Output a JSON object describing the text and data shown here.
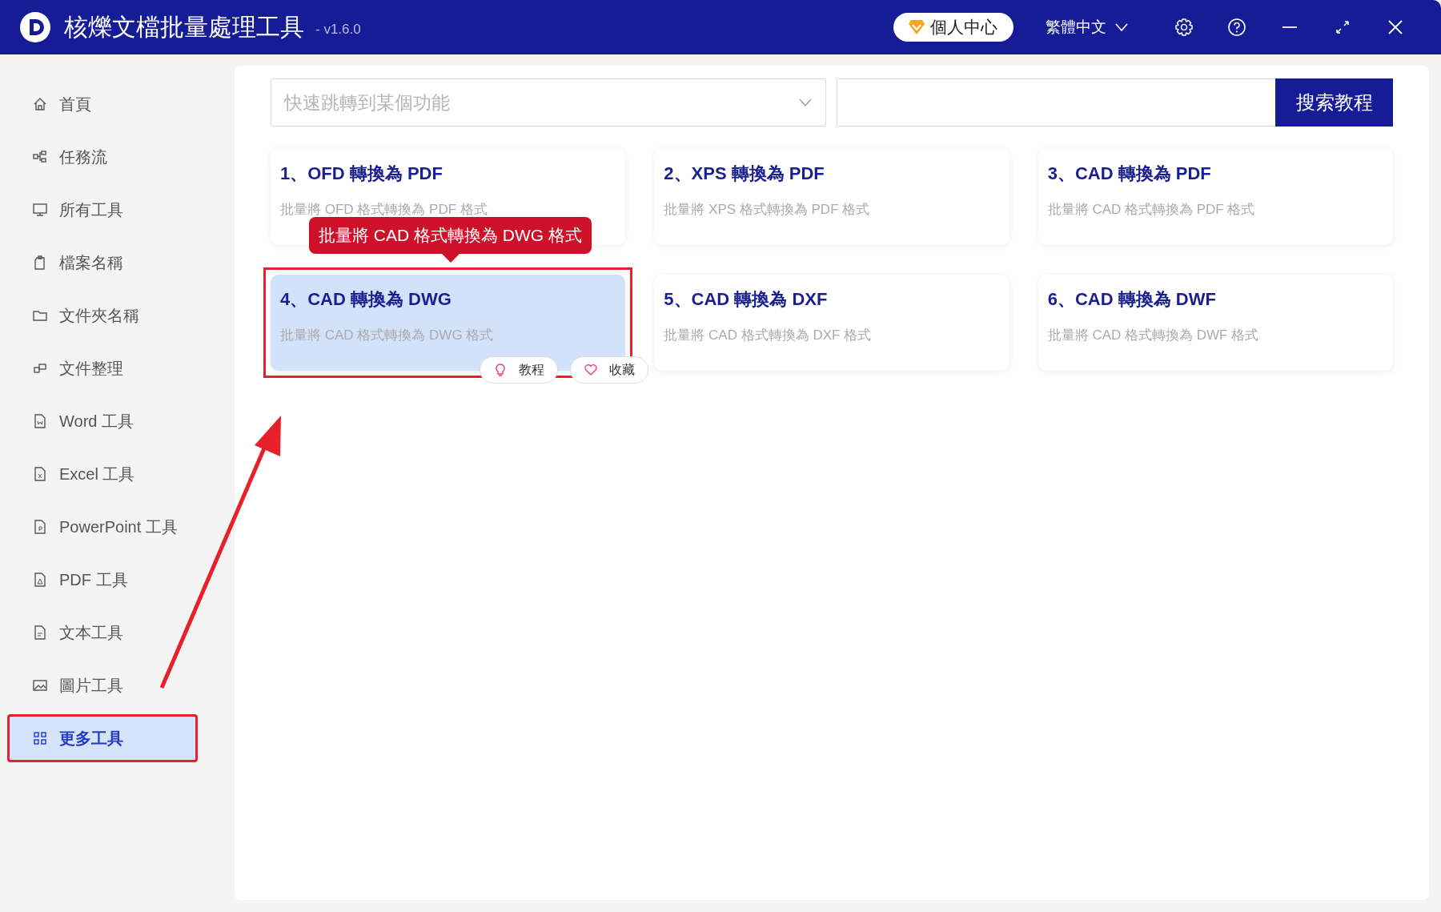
{
  "window": {
    "title": "核爍文檔批量處理工具",
    "version": "- v1.6.0"
  },
  "header": {
    "account_button": "個人中心",
    "language": "繁體中文"
  },
  "sidebar": {
    "items": [
      {
        "label": "首頁",
        "selected": false,
        "highlighted": false
      },
      {
        "label": "任務流",
        "selected": false,
        "highlighted": false
      },
      {
        "label": "所有工具",
        "selected": false,
        "highlighted": false
      },
      {
        "label": "檔案名稱",
        "selected": false,
        "highlighted": false
      },
      {
        "label": "文件夾名稱",
        "selected": false,
        "highlighted": false
      },
      {
        "label": "文件整理",
        "selected": false,
        "highlighted": false
      },
      {
        "label": "Word 工具",
        "selected": false,
        "highlighted": false
      },
      {
        "label": "Excel 工具",
        "selected": false,
        "highlighted": false
      },
      {
        "label": "PowerPoint 工具",
        "selected": false,
        "highlighted": false
      },
      {
        "label": "PDF 工具",
        "selected": false,
        "highlighted": false
      },
      {
        "label": "文本工具",
        "selected": false,
        "highlighted": false
      },
      {
        "label": "圖片工具",
        "selected": false,
        "highlighted": false
      },
      {
        "label": "更多工具",
        "selected": true,
        "highlighted": true
      }
    ]
  },
  "search": {
    "placeholder": "快速跳轉到某個功能",
    "button": "搜索教程"
  },
  "cards": [
    {
      "title": "1、OFD 轉換為 PDF",
      "description": "批量將 OFD 格式轉換為 PDF 格式",
      "selected": false,
      "highlighted": false
    },
    {
      "title": "2、XPS 轉換為 PDF",
      "description": "批量將 XPS 格式轉換為 PDF 格式",
      "selected": false,
      "highlighted": false
    },
    {
      "title": "3、CAD 轉換為 PDF",
      "description": "批量將 CAD 格式轉換為 PDF 格式",
      "selected": false,
      "highlighted": false
    },
    {
      "title": "4、CAD 轉換為 DWG",
      "description": "批量將 CAD 格式轉換為 DWG 格式",
      "selected": true,
      "highlighted": true,
      "tooltip": "批量將 CAD 格式轉換為 DWG 格式",
      "actions": [
        "教程",
        "收藏"
      ]
    },
    {
      "title": "5、CAD 轉換為 DXF",
      "description": "批量將 CAD 格式轉換為 DXF 格式",
      "selected": false,
      "highlighted": false
    },
    {
      "title": "6、CAD 轉換為 DWF",
      "description": "批量將 CAD 格式轉換為 DWF 格式",
      "selected": false,
      "highlighted": false
    }
  ]
}
